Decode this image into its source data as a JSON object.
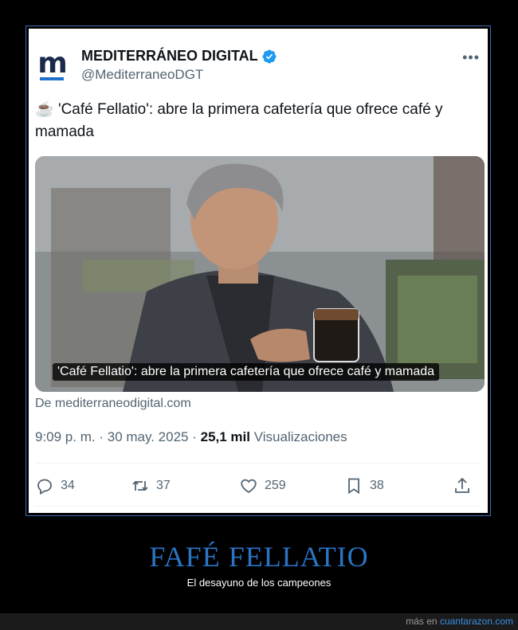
{
  "account": {
    "name": "MEDITERRÁNEO DIGITAL",
    "handle": "@MediterraneoDGT",
    "avatar_letter": "m",
    "verified": true,
    "verified_color": "#1d9bf0"
  },
  "tweet": {
    "emoji": "☕",
    "text": "'Café Fellatio': abre la primera cafetería que ofrece café y mamada",
    "media_caption": "'Café Fellatio': abre la primera cafetería que ofrece café y mamada",
    "source": "De mediterraneodigital.com",
    "time": "9:09 p. m.",
    "date": "30 may. 2025",
    "views_count": "25,1 mil",
    "views_label": "Visualizaciones"
  },
  "actions": {
    "replies": "34",
    "retweets": "37",
    "likes": "259",
    "bookmarks": "38"
  },
  "meme": {
    "title": "FAFÉ FELLATIO",
    "subtitle": "El desayuno de los campeones"
  },
  "footer": {
    "prefix": "más en",
    "site": "cuantarazon.com"
  },
  "colors": {
    "accent": "#2a74c4",
    "link": "#3b8fe0",
    "muted_text": "#536471"
  }
}
